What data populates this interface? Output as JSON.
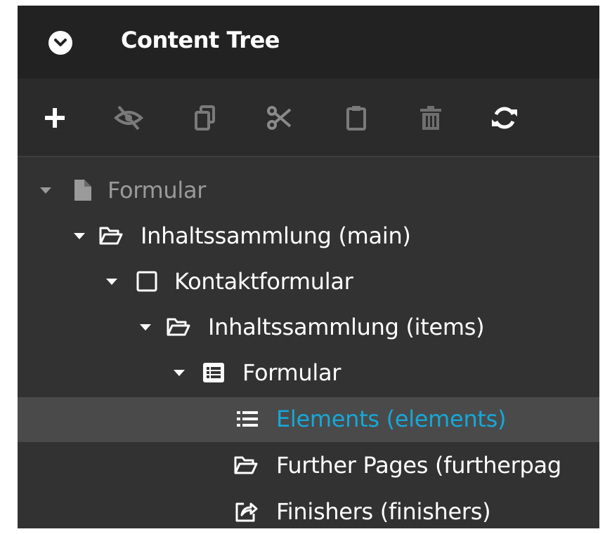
{
  "header": {
    "title": "Content Tree"
  },
  "toolbar": {
    "buttons": [
      {
        "name": "add-button",
        "icon": "plus-icon"
      },
      {
        "name": "hide-button",
        "icon": "eye-slash-icon"
      },
      {
        "name": "copy-button",
        "icon": "copy-icon"
      },
      {
        "name": "cut-button",
        "icon": "scissors-icon"
      },
      {
        "name": "paste-button",
        "icon": "clipboard-icon"
      },
      {
        "name": "delete-button",
        "icon": "trash-icon"
      },
      {
        "name": "refresh-button",
        "icon": "refresh-icon"
      }
    ]
  },
  "tree": {
    "nodes": [
      {
        "label": "Formular",
        "icon": "document-icon",
        "expanded": true,
        "level": 0,
        "muted": true
      },
      {
        "label": "Inhaltssammlung (main)",
        "icon": "folder-open-icon",
        "expanded": true,
        "level": 1
      },
      {
        "label": "Kontaktformular",
        "icon": "square-icon",
        "expanded": true,
        "level": 2
      },
      {
        "label": "Inhaltssammlung (items)",
        "icon": "folder-open-icon",
        "expanded": true,
        "level": 3
      },
      {
        "label": "Formular",
        "icon": "list-box-icon",
        "expanded": true,
        "level": 4
      },
      {
        "label": "Elements (elements)",
        "icon": "list-icon",
        "level": 5,
        "selected": true
      },
      {
        "label": "Further Pages (furtherpag",
        "icon": "folder-open-icon",
        "level": 5
      },
      {
        "label": "Finishers (finishers)",
        "icon": "share-square-icon",
        "level": 5
      }
    ]
  },
  "colors": {
    "panel_background": "#323232",
    "header_background": "#222222",
    "selected_row": "#4a4a4a",
    "active_text": "#16a8d8",
    "muted_text": "#9a9a9a"
  }
}
